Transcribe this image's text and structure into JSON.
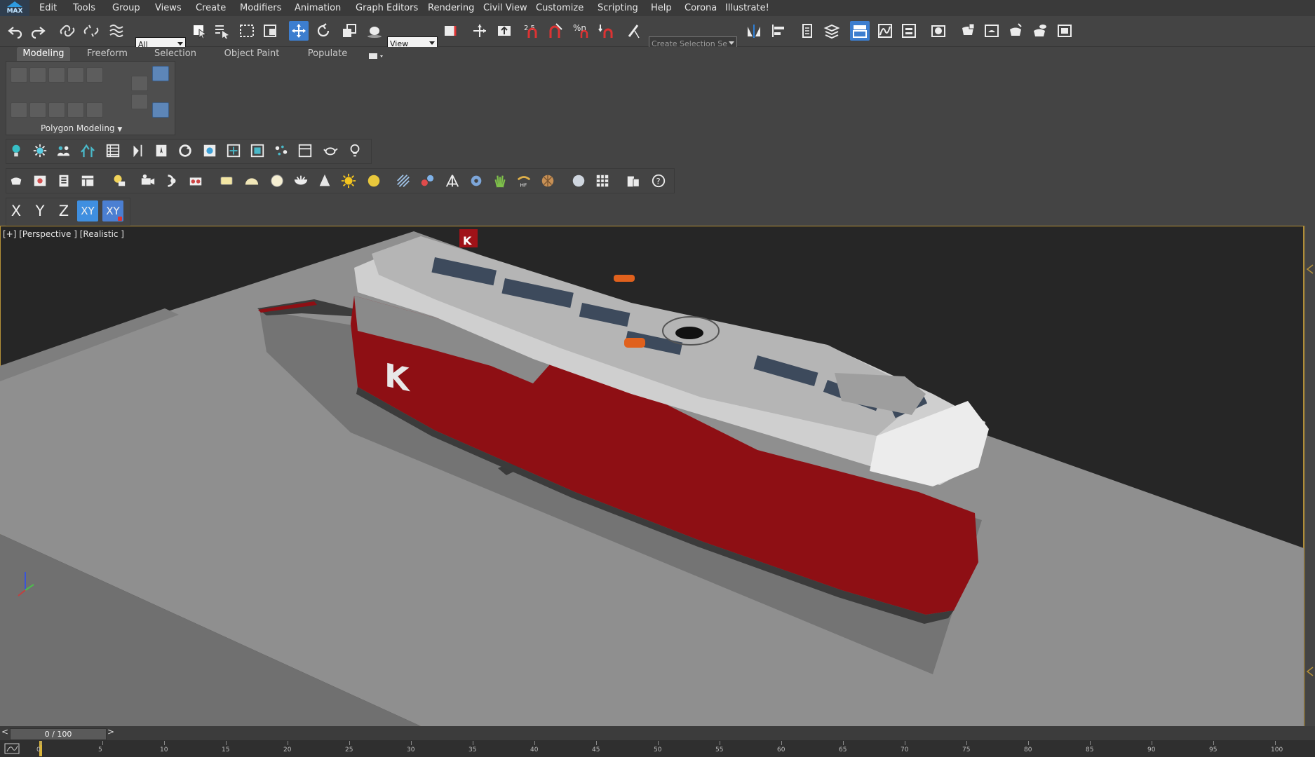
{
  "app": {
    "logo_text": "MAX"
  },
  "menu": [
    "Edit",
    "Tools",
    "Group",
    "Views",
    "Create",
    "Modifiers",
    "Animation",
    "Graph Editors",
    "Rendering",
    "Civil View",
    "Customize",
    "Scripting",
    "Help",
    "Corona",
    "Illustrate!"
  ],
  "toolbar": {
    "selection_filter": "All",
    "reference_coord": "View",
    "snap_angle": "2.5",
    "snap_percent": "%n",
    "named_selection_placeholder": "Create Selection Se"
  },
  "ribbon": {
    "tabs": [
      "Modeling",
      "Freeform",
      "Selection",
      "Object Paint",
      "Populate"
    ],
    "panel_label": "Polygon Modeling"
  },
  "axis_constraints": [
    "X",
    "Y",
    "Z",
    "XY",
    "XY"
  ],
  "viewport": {
    "label": "[+] [Perspective ] [Realistic ]",
    "hull_letter": "K",
    "colors": {
      "hull_red": "#8e0f14",
      "hull_white": "#e9e9e9",
      "ground": "#8f8f8f",
      "background": "#262626",
      "border": "#b69238"
    }
  },
  "timeline": {
    "slider_text": "0 / 100",
    "prev": "<",
    "next": ">",
    "ticks": [
      "0",
      "5",
      "10",
      "15",
      "20",
      "25",
      "30",
      "35",
      "40",
      "45",
      "50",
      "55",
      "60",
      "65",
      "70",
      "75",
      "80",
      "85",
      "90",
      "95",
      "100"
    ]
  }
}
